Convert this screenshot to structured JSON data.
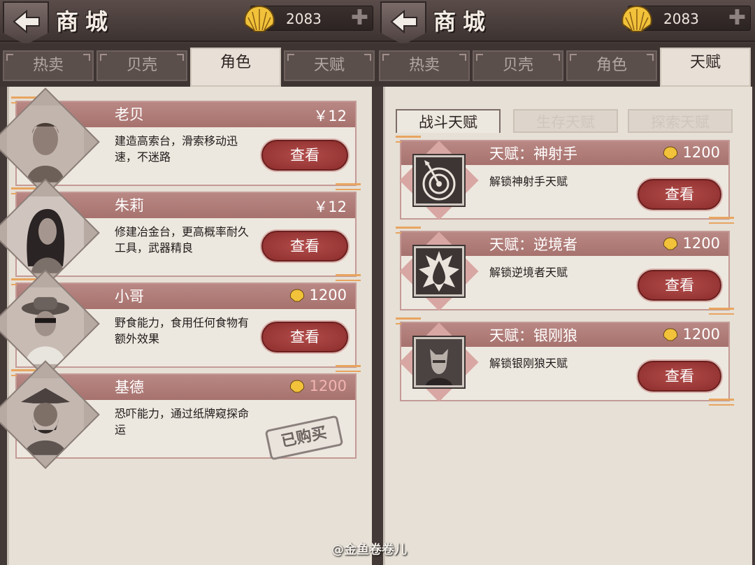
{
  "left": {
    "header": {
      "title": "商城",
      "coins": "2083"
    },
    "tabs": [
      "热卖",
      "贝壳",
      "角色",
      "天赋"
    ],
    "active_tab": "角色",
    "cards": [
      {
        "name": "老贝",
        "price": "￥12",
        "desc": "建造高索台，滑索移动迅速，不迷路",
        "button": "查看"
      },
      {
        "name": "朱莉",
        "price": "￥12",
        "desc": "修建冶金台，更高概率耐久工具，武器精良",
        "button": "查看"
      },
      {
        "name": "小哥",
        "price": "1200",
        "desc": "野食能力，食用任何食物有额外效果",
        "button": "查看"
      },
      {
        "name": "基德",
        "price": "1200",
        "desc": "恐吓能力，通过纸牌窥探命运",
        "status": "已购买"
      }
    ]
  },
  "right": {
    "header": {
      "title": "商城",
      "coins": "2083"
    },
    "tabs": [
      "热卖",
      "贝壳",
      "角色",
      "天赋"
    ],
    "active_tab": "天赋",
    "subtabs": [
      "战斗天赋",
      "生存天赋",
      "探索天赋"
    ],
    "cards": [
      {
        "name": "天赋：神射手",
        "price": "1200",
        "desc": "解锁神射手天赋",
        "button": "查看",
        "icon": "target-arrow-icon"
      },
      {
        "name": "天赋：逆境者",
        "price": "1200",
        "desc": "解锁逆境者天赋",
        "button": "查看",
        "icon": "drop-burst-icon"
      },
      {
        "name": "天赋：银刚狼",
        "price": "1200",
        "desc": "解锁银刚狼天赋",
        "button": "查看",
        "icon": "wolverine-portrait-icon"
      }
    ]
  },
  "watermark": "@金鱼卷卷儿",
  "colors": {
    "band": "#b07a76",
    "button": "#9e3a38",
    "parchment": "#e6e0d6",
    "frame": "#433937"
  }
}
